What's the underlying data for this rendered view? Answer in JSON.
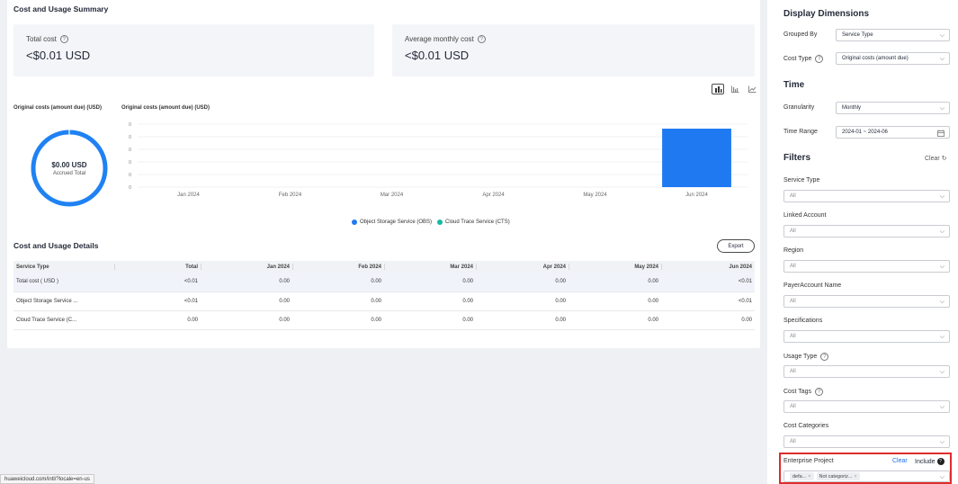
{
  "summary": {
    "title": "Cost and Usage Summary",
    "total_cost_label": "Total cost",
    "total_cost_value": "<$0.01 USD",
    "avg_cost_label": "Average monthly cost",
    "avg_cost_value": "<$0.01 USD"
  },
  "donut": {
    "title": "Original costs (amount due) (USD)",
    "value": "$0.00 USD",
    "subtitle": "Accrued Total",
    "color": "#1f82f3"
  },
  "chart_data": {
    "type": "bar",
    "title": "Original costs (amount due) (USD)",
    "categories": [
      "Jan 2024",
      "Feb 2024",
      "Mar 2024",
      "Apr 2024",
      "May 2024",
      "Jun 2024"
    ],
    "y_ticks": [
      "0",
      "0",
      "0",
      "0",
      "0",
      "0"
    ],
    "series": [
      {
        "name": "Object Storage Service (OBS)",
        "color": "#1f7af2",
        "values": [
          0,
          0,
          0,
          0,
          0,
          1
        ]
      },
      {
        "name": "Cloud Trace Service (CTS)",
        "color": "#15b8a6",
        "values": [
          0,
          0,
          0,
          0,
          0,
          0
        ]
      }
    ],
    "grid": true,
    "legend": "bottom"
  },
  "details": {
    "title": "Cost and Usage Details",
    "export_label": "Export",
    "headers": [
      "Service Type",
      "Total",
      "Jan 2024",
      "Feb 2024",
      "Mar 2024",
      "Apr 2024",
      "May 2024",
      "Jun 2024"
    ],
    "rows": [
      [
        "Total cost ( USD )",
        "<0.01",
        "0.00",
        "0.00",
        "0.00",
        "0.00",
        "0.00",
        "<0.01"
      ],
      [
        "Object Storage Service ...",
        "<0.01",
        "0.00",
        "0.00",
        "0.00",
        "0.00",
        "0.00",
        "<0.01"
      ],
      [
        "Cloud Trace Service (C...",
        "0.00",
        "0.00",
        "0.00",
        "0.00",
        "0.00",
        "0.00",
        "0.00"
      ]
    ]
  },
  "panel": {
    "display_title": "Display Dimensions",
    "grouped_by_label": "Grouped By",
    "grouped_by_value": "Service Type",
    "cost_type_label": "Cost Type",
    "cost_type_value": "Original costs (amount due)",
    "time_title": "Time",
    "granularity_label": "Granularity",
    "granularity_value": "Monthly",
    "time_range_label": "Time Range",
    "time_range_value": "2024-01 ~ 2024-06",
    "filters_title": "Filters",
    "filters_clear": "Clear",
    "filters": [
      {
        "label": "Service Type",
        "value": "All",
        "help": false
      },
      {
        "label": "Linked Account",
        "value": "All",
        "help": false
      },
      {
        "label": "Region",
        "value": "All",
        "help": false
      },
      {
        "label": "PayerAccount Name",
        "value": "All",
        "help": false
      },
      {
        "label": "Specifications",
        "value": "All",
        "help": false
      },
      {
        "label": "Usage Type",
        "value": "All",
        "help": true
      },
      {
        "label": "Cost Tags",
        "value": "All",
        "help": true
      },
      {
        "label": "Cost Categories",
        "value": "All",
        "help": false
      }
    ],
    "enterprise_project": {
      "label": "Enterprise Project",
      "clear": "Clear",
      "include": "Include",
      "tags": [
        "defa...",
        "Not categoriz..."
      ]
    }
  },
  "status_url": "huaweicloud.com/intl/?locale=en-us"
}
